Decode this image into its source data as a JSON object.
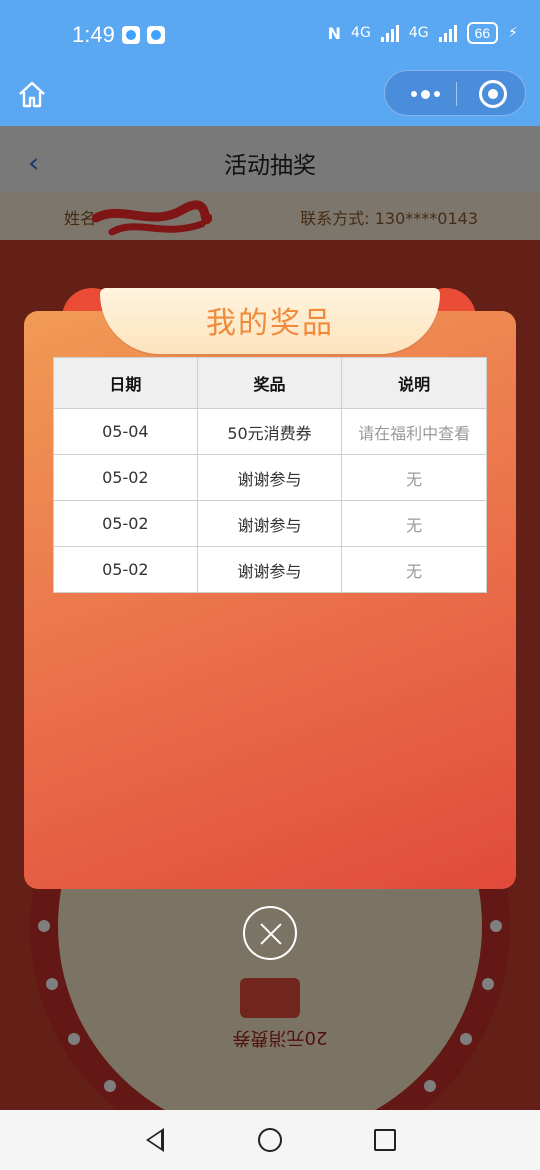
{
  "status_bar": {
    "time": "1:49",
    "network_1": "4G",
    "network_2": "4G",
    "battery": "66"
  },
  "header": {
    "home_icon": "home-icon",
    "more_icon": "more-dots-icon",
    "close_icon": "target-circle-icon"
  },
  "page": {
    "nav_title": "活动抽奖",
    "back_icon": "chevron-left-icon",
    "user": {
      "name_label": "姓名",
      "contact_label": "联系方式:",
      "contact_value": "130****0143"
    },
    "wheel_label": "20元消费券"
  },
  "modal": {
    "title": "我的奖品",
    "columns": [
      "日期",
      "奖品",
      "说明"
    ],
    "rows": [
      {
        "date": "05-04",
        "prize": "50元消费券",
        "note": "请在福利中查看"
      },
      {
        "date": "05-02",
        "prize": "谢谢参与",
        "note": "无"
      },
      {
        "date": "05-02",
        "prize": "谢谢参与",
        "note": "无"
      },
      {
        "date": "05-02",
        "prize": "谢谢参与",
        "note": "无"
      }
    ]
  },
  "colors": {
    "header_blue": "#5aa7f2",
    "modal_gradient_start": "#f09b55",
    "modal_gradient_end": "#e14a3c",
    "title_orange": "#f08a3a"
  }
}
